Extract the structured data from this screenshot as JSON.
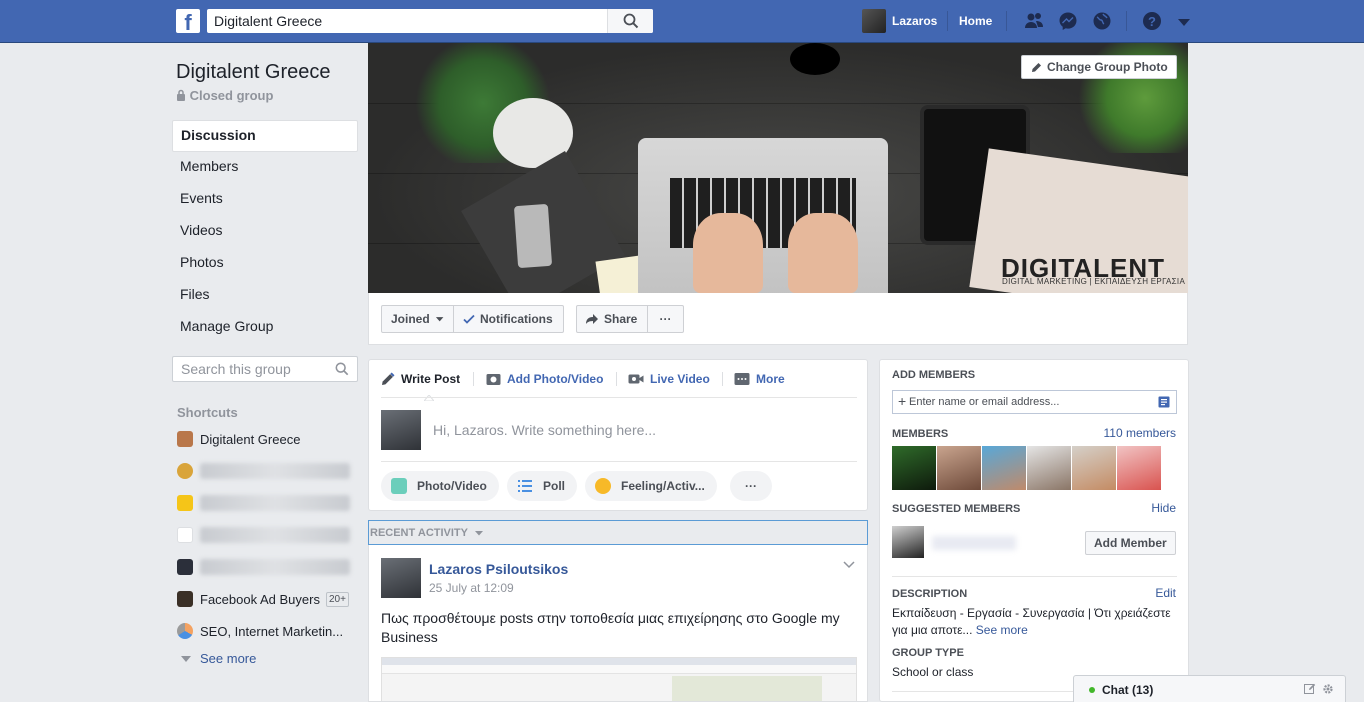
{
  "topbar": {
    "logo": "f",
    "search_value": "Digitalent Greece",
    "user_name": "Lazaros",
    "home_label": "Home"
  },
  "group": {
    "name": "Digitalent Greece",
    "type": "Closed group"
  },
  "nav": [
    {
      "label": "Discussion",
      "active": true
    },
    {
      "label": "Members"
    },
    {
      "label": "Events"
    },
    {
      "label": "Videos"
    },
    {
      "label": "Photos"
    },
    {
      "label": "Files"
    },
    {
      "label": "Manage Group"
    }
  ],
  "group_search_placeholder": "Search this group",
  "shortcuts": {
    "label": "Shortcuts",
    "items": [
      {
        "label": "Digitalent Greece"
      },
      {
        "label": "Facebook Ad Buyers",
        "badge": "20+"
      },
      {
        "label": "SEO, Internet Marketin..."
      }
    ],
    "see_more": "See more"
  },
  "cover": {
    "change_photo_label": "Change Group Photo",
    "brand": "DIGITALENT",
    "brand_sub": "DIGITAL MARKETING | ΕΚΠΑΙΔΕΥΣΗ ΕΡΓΑΣΙΑ"
  },
  "actions": {
    "joined": "Joined",
    "notifications": "Notifications",
    "share": "Share",
    "more": "···"
  },
  "composer": {
    "tabs": [
      "Write Post",
      "Add Photo/Video",
      "Live Video",
      "More"
    ],
    "prompt": "Hi, Lazaros. Write something here...",
    "pills": [
      "Photo/Video",
      "Poll",
      "Feeling/Activ...",
      "···"
    ]
  },
  "recent_activity_label": "RECENT ACTIVITY",
  "post": {
    "author": "Lazaros Psiloutsikos",
    "date": "25 July at 12:09",
    "text": "Πως προσθέτουμε posts στην τοποθεσία μιας επιχείρησης στο Google my Business"
  },
  "right": {
    "add_members_head": "ADD MEMBERS",
    "add_placeholder": "Enter name or email address...",
    "members_head": "MEMBERS",
    "members_count": "110 members",
    "suggested_head": "SUGGESTED MEMBERS",
    "hide": "Hide",
    "add_member_btn": "Add Member",
    "description_head": "DESCRIPTION",
    "edit": "Edit",
    "description_text": "Εκπαίδευση - Εργασία - Συνεργασία | Ότι χρειάζεστε για μια αποτε...",
    "see_more": "See more",
    "group_type_head": "GROUP TYPE",
    "group_type_value": "School or class"
  },
  "chat": {
    "label": "Chat (13)"
  },
  "colors": {
    "fb_blue": "#4267b2",
    "link": "#365899",
    "online": "#42b72a"
  }
}
